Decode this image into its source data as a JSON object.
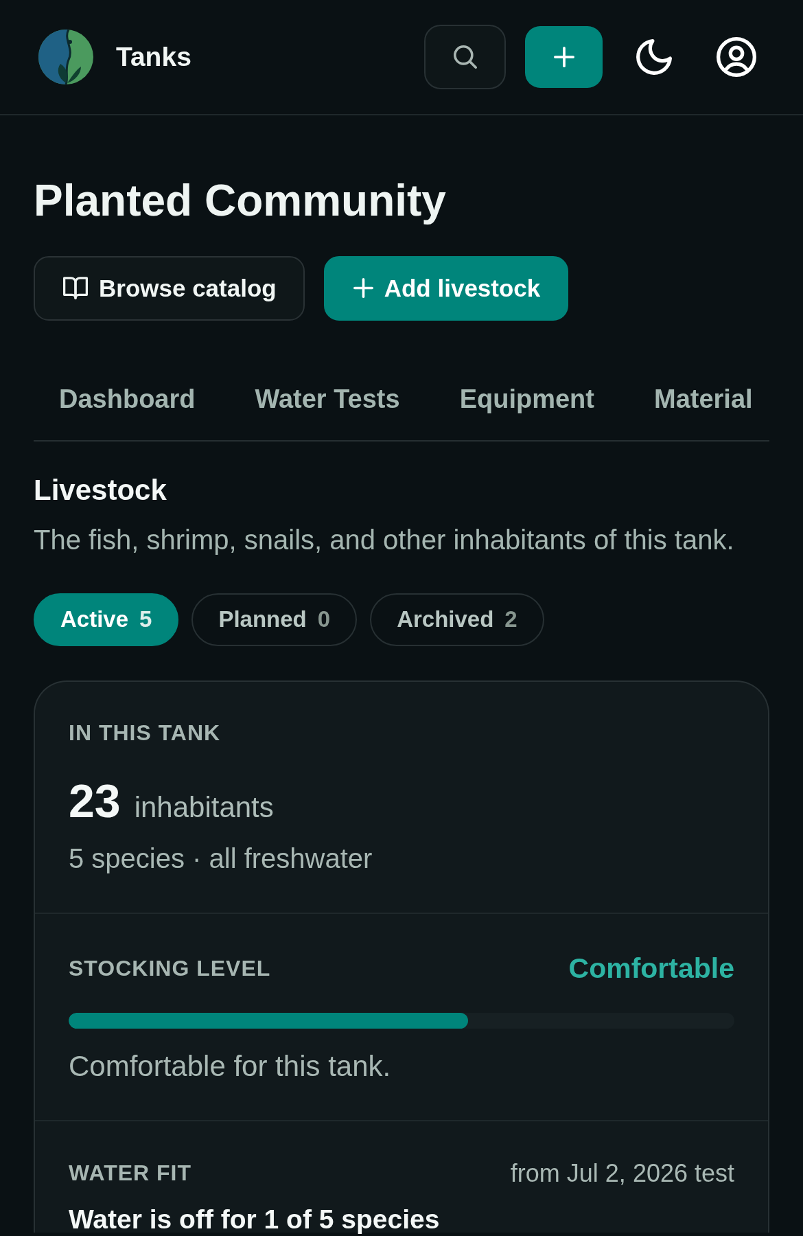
{
  "header": {
    "title": "Tanks"
  },
  "page": {
    "title": "Planted Community",
    "actions": [
      {
        "label": "Browse catalog",
        "kind": "secondary"
      },
      {
        "label": "Add livestock",
        "kind": "primary"
      }
    ]
  },
  "tabs": [
    {
      "label": "Dashboard",
      "selected": false
    },
    {
      "label": "Water Tests",
      "selected": false
    },
    {
      "label": "Equipment",
      "selected": false
    },
    {
      "label": "Material",
      "selected": false
    }
  ],
  "section": {
    "title": "Livestock",
    "description": "The fish, shrimp, snails, and other inhabitants of this tank."
  },
  "filters": [
    {
      "label": "Active",
      "count": "5",
      "selected": true
    },
    {
      "label": "Planned",
      "count": "0",
      "selected": false
    },
    {
      "label": "Archived",
      "count": "2",
      "selected": false
    }
  ],
  "summary": {
    "heading": "IN THIS TANK",
    "total": "23",
    "total_label": "inhabitants",
    "detail": "5 species · all freshwater"
  },
  "stocking": {
    "heading": "STOCKING LEVEL",
    "status": "Comfortable",
    "level": 0.6,
    "note": "Comfortable for this tank."
  },
  "water_fit": {
    "heading": "WATER FIT",
    "source": "from Jul 2, 2026 test",
    "verdict": "Water is off for 1 of 5 species"
  }
}
